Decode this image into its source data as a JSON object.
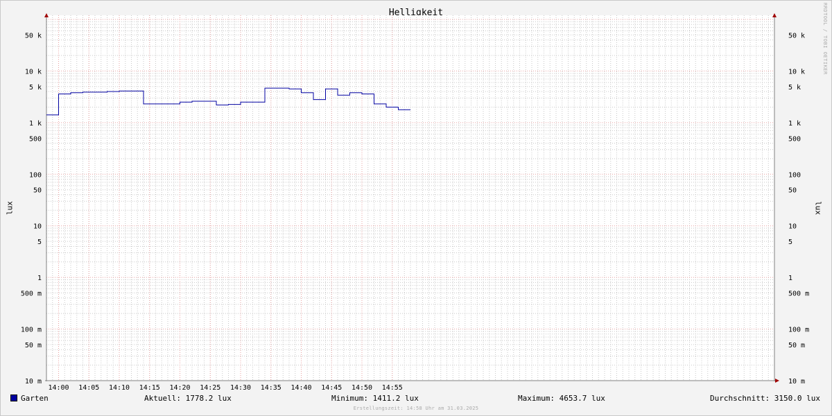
{
  "chart_data": {
    "type": "line",
    "title": "Helligkeit",
    "ylabel": "lux",
    "yscale": "log",
    "ylim": [
      0.01,
      100000
    ],
    "xlim": [
      "13:58",
      "15:58"
    ],
    "x_ticks": [
      "14:00",
      "14:05",
      "14:10",
      "14:15",
      "14:20",
      "14:25",
      "14:30",
      "14:35",
      "14:40",
      "14:45",
      "14:50",
      "14:55"
    ],
    "y_ticks": [
      {
        "value": 50000,
        "label": "50 k"
      },
      {
        "value": 10000,
        "label": "10 k"
      },
      {
        "value": 5000,
        "label": "5 k"
      },
      {
        "value": 1000,
        "label": "1 k"
      },
      {
        "value": 500,
        "label": "500"
      },
      {
        "value": 100,
        "label": "100"
      },
      {
        "value": 50,
        "label": "50"
      },
      {
        "value": 10,
        "label": "10"
      },
      {
        "value": 5,
        "label": "5"
      },
      {
        "value": 1,
        "label": "1"
      },
      {
        "value": 0.5,
        "label": "500 m"
      },
      {
        "value": 0.1,
        "label": "100 m"
      },
      {
        "value": 0.05,
        "label": "50 m"
      },
      {
        "value": 0.01,
        "label": "10 m"
      }
    ],
    "series": [
      {
        "name": "Garten",
        "color": "#0000a0",
        "step": "post",
        "x": [
          "13:58",
          "14:00",
          "14:02",
          "14:04",
          "14:08",
          "14:10",
          "14:14",
          "14:20",
          "14:22",
          "14:26",
          "14:28",
          "14:30",
          "14:34",
          "14:38",
          "14:40",
          "14:42",
          "14:44",
          "14:46",
          "14:48",
          "14:50",
          "14:52",
          "14:54",
          "14:56",
          "14:58"
        ],
        "values": [
          1411,
          3600,
          3800,
          3900,
          4000,
          4100,
          2300,
          2500,
          2600,
          2200,
          2250,
          2500,
          4650,
          4500,
          3800,
          2800,
          4500,
          3400,
          3800,
          3600,
          2300,
          2000,
          1778,
          1778
        ]
      }
    ],
    "grid": true
  },
  "legend": {
    "series_name": "Garten",
    "current": "Aktuell: 1778.2 lux",
    "minimum": "Minimum: 1411.2 lux",
    "maximum": "Maximum: 4653.7 lux",
    "average": "Durchschnitt: 3150.0 lux"
  },
  "watermark": "RRDTOOL / TOBI OETIKER",
  "footer": "Erstellungszeit: 14:58 Uhr am 31.03.2025",
  "colors": {
    "series": "#0000a0",
    "major_grid": "#e8a0a0",
    "minor_grid": "#c8c8c8",
    "axis": "#808080",
    "arrow": "#a00000"
  }
}
